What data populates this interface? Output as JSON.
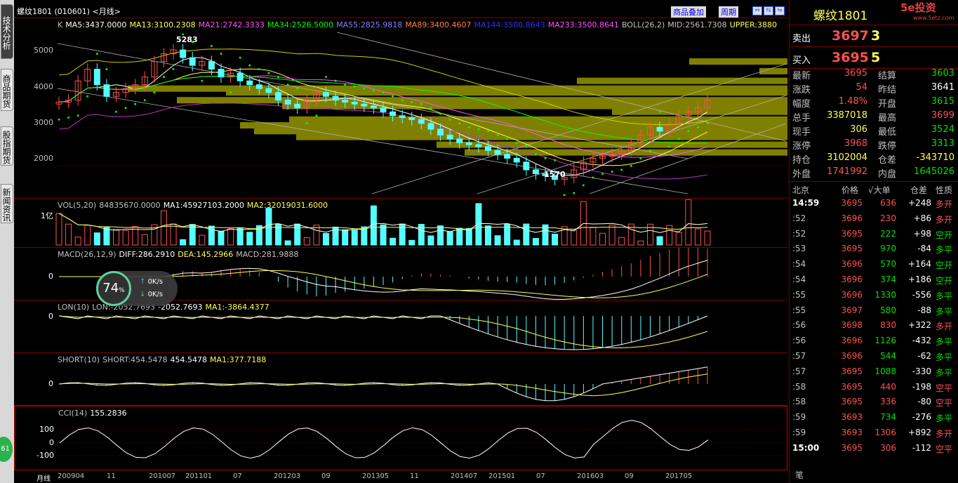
{
  "left_tabs": [
    "技术分析",
    "商品期货",
    "股指期货",
    "新闻资讯"
  ],
  "left_badge": "61",
  "header": {
    "title": "螺纹1801 (010601) <月线>",
    "menu_overlay": "商品叠加",
    "menu_period": "周期"
  },
  "main_panel": {
    "legend": [
      {
        "text": "K",
        "color": "#c0c0c0"
      },
      {
        "text": "MA5:3437.0000",
        "color": "#ffffff"
      },
      {
        "text": "MA13:3100.2308",
        "color": "#ffff54"
      },
      {
        "text": "MA21:2742.3333",
        "color": "#ff50ff"
      },
      {
        "text": "MA34:2526.5000",
        "color": "#00ff00"
      },
      {
        "text": "MA55:2825.9818",
        "color": "#8080ff"
      },
      {
        "text": "MA89:3400.4607",
        "color": "#ff8040"
      },
      {
        "text": "MA144:3500.8643",
        "color": "#3030ff"
      },
      {
        "text": "MA233:3500.8641",
        "color": "#ff50ff"
      },
      {
        "text": "BOLL(26,2)",
        "color": "#c0c0c0"
      },
      {
        "text": "MID:2561.7308",
        "color": "#c0c0c0"
      },
      {
        "text": "UPPER:3880",
        "color": "#ffff54"
      }
    ],
    "y_labels": [
      "5000",
      "4000",
      "3000",
      "2000"
    ],
    "high_label": "5283",
    "low_label": "1570"
  },
  "vol_panel": {
    "legend": [
      {
        "text": "VOL(5,20)",
        "color": "#c0c0c0"
      },
      {
        "text": "84835670.0000",
        "color": "#c0c0c0"
      },
      {
        "text": "MA1:45927103.2000",
        "color": "#ffffff"
      },
      {
        "text": "MA2:32019031.6000",
        "color": "#ffff54"
      }
    ],
    "y_label": "1亿"
  },
  "macd_panel": {
    "legend": [
      {
        "text": "MACD(26,12,9)",
        "color": "#c0c0c0"
      },
      {
        "text": "DIFF:286.2910",
        "color": "#ffffff"
      },
      {
        "text": "DEA:145.2966",
        "color": "#ffff54"
      },
      {
        "text": "MACD:281.9888",
        "color": "#c0c0c0"
      }
    ],
    "y_label": "0"
  },
  "lon_panel": {
    "legend": [
      {
        "text": "LON(10)",
        "color": "#c0c0c0"
      },
      {
        "text": "LON:-2052.7693",
        "color": "#c0c0c0"
      },
      {
        "text": "-2052.7693",
        "color": "#ffffff"
      },
      {
        "text": "MA1:-3864.4377",
        "color": "#ffff54"
      }
    ],
    "y_label": "0"
  },
  "short_panel": {
    "legend": [
      {
        "text": "SHORT(10)",
        "color": "#c0c0c0"
      },
      {
        "text": "SHORT:454.5478",
        "color": "#c0c0c0"
      },
      {
        "text": "454.5478",
        "color": "#ffffff"
      },
      {
        "text": "MA1:377.7188",
        "color": "#ffff54"
      }
    ],
    "y_label": "0"
  },
  "cci_panel": {
    "legend": [
      {
        "text": "CCI(14)",
        "color": "#c0c0c0"
      },
      {
        "text": "155.2836",
        "color": "#ffffff"
      }
    ],
    "y_labels": [
      "100",
      "0",
      "-100"
    ]
  },
  "x_axis": {
    "period": "月线",
    "labels": [
      "200904",
      "11",
      "201007",
      "201101",
      "07",
      "201203",
      "09",
      "201305",
      "11",
      "201407",
      "201501",
      "07",
      "201603",
      "09",
      "201705"
    ]
  },
  "network": {
    "percent": "74",
    "unit": "%",
    "up": "0K/s",
    "down": "0K/s"
  },
  "right_panel": {
    "title": "螺纹1801",
    "logo": "5e投资",
    "logo_sub": "www.5etz.com",
    "sell_label": "卖出",
    "sell_price": "3697",
    "sell_vol": "3",
    "buy_label": "买入",
    "buy_price": "3695",
    "buy_vol": "5",
    "quotes": [
      {
        "l1": "最新",
        "v1": "3695",
        "c1": "red",
        "l2": "结算",
        "v2": "3603",
        "c2": "green"
      },
      {
        "l1": "涨跌",
        "v1": "54",
        "c1": "red",
        "l2": "昨结",
        "v2": "3641",
        "c2": "white"
      },
      {
        "l1": "幅度",
        "v1": "1.48%",
        "c1": "red",
        "l2": "开盘",
        "v2": "3615",
        "c2": "green"
      },
      {
        "l1": "总手",
        "v1": "3387018",
        "c1": "yellow",
        "l2": "最高",
        "v2": "3699",
        "c2": "red"
      },
      {
        "l1": "现手",
        "v1": "306",
        "c1": "yellow",
        "l2": "最低",
        "v2": "3524",
        "c2": "green"
      },
      {
        "l1": "涨停",
        "v1": "3968",
        "c1": "red",
        "l2": "跌停",
        "v2": "3313",
        "c2": "green"
      },
      {
        "l1": "持仓",
        "v1": "3102004",
        "c1": "yellow",
        "l2": "仓差",
        "v2": "-343710",
        "c2": "yellow"
      },
      {
        "l1": "外盘",
        "v1": "1741992",
        "c1": "red",
        "l2": "内盘",
        "v2": "1645026",
        "c2": "green"
      }
    ],
    "tick_header": {
      "time": "北京",
      "price": "价格",
      "vol": "√大单",
      "oi": "仓差",
      "nature": "性质"
    },
    "ticks": [
      {
        "time": "14:59",
        "price": "3695",
        "vol": "636",
        "vc": "red",
        "oi": "+248",
        "nat": "多开",
        "nc": "red"
      },
      {
        "time": ":52",
        "price": "3696",
        "vol": "230",
        "vc": "red",
        "oi": "+86",
        "nat": "多开",
        "nc": "red"
      },
      {
        "time": ":52",
        "price": "3695",
        "vol": "222",
        "vc": "green",
        "oi": "+98",
        "nat": "空开",
        "nc": "green"
      },
      {
        "time": ":53",
        "price": "3695",
        "vol": "970",
        "vc": "green",
        "oi": "-84",
        "nat": "多平",
        "nc": "green"
      },
      {
        "time": ":54",
        "price": "3696",
        "vol": "570",
        "vc": "green",
        "oi": "+164",
        "nat": "空开",
        "nc": "green"
      },
      {
        "time": ":54",
        "price": "3696",
        "vol": "374",
        "vc": "green",
        "oi": "+186",
        "nat": "空开",
        "nc": "green"
      },
      {
        "time": ":55",
        "price": "3696",
        "vol": "1330",
        "vc": "green",
        "oi": "-556",
        "nat": "多平",
        "nc": "green"
      },
      {
        "time": ":55",
        "price": "3697",
        "vol": "580",
        "vc": "green",
        "oi": "-88",
        "nat": "多平",
        "nc": "green"
      },
      {
        "time": ":56",
        "price": "3698",
        "vol": "830",
        "vc": "red",
        "oi": "+322",
        "nat": "多开",
        "nc": "red"
      },
      {
        "time": ":56",
        "price": "3696",
        "vol": "1126",
        "vc": "green",
        "oi": "-432",
        "nat": "多平",
        "nc": "green"
      },
      {
        "time": ":57",
        "price": "3696",
        "vol": "544",
        "vc": "green",
        "oi": "-62",
        "nat": "多平",
        "nc": "green"
      },
      {
        "time": ":57",
        "price": "3695",
        "vol": "1088",
        "vc": "green",
        "oi": "-330",
        "nat": "多平",
        "nc": "green"
      },
      {
        "time": ":58",
        "price": "3695",
        "vol": "440",
        "vc": "red",
        "oi": "-198",
        "nat": "空平",
        "nc": "red"
      },
      {
        "time": ":58",
        "price": "3695",
        "vol": "336",
        "vc": "red",
        "oi": "-80",
        "nat": "空平",
        "nc": "red"
      },
      {
        "time": ":59",
        "price": "3693",
        "vol": "734",
        "vc": "green",
        "oi": "-276",
        "nat": "多平",
        "nc": "green"
      },
      {
        "time": ":59",
        "price": "3693",
        "vol": "1306",
        "vc": "red",
        "oi": "+892",
        "nat": "多开",
        "nc": "red"
      },
      {
        "time": "15:00",
        "price": "3695",
        "vol": "306",
        "vc": "red",
        "oi": "-112",
        "nat": "空平",
        "nc": "red"
      }
    ],
    "footer": "笔"
  },
  "colors": {
    "up": "#ff5050",
    "down": "#54ffff",
    "grid": "#7a0000",
    "ma_white": "#ffffff",
    "ma_yellow": "#ffff54",
    "ma_magenta": "#ff50ff",
    "ma_green": "#00ff00",
    "sar": "#00ff00",
    "volume_profile": "#808000"
  },
  "chart_data": {
    "type": "candlestick",
    "title": "螺纹1801 (010601) <月线>",
    "ylim": [
      1300,
      5600
    ],
    "approx_monthly_close": [
      3650,
      3700,
      4200,
      4500,
      4100,
      3800,
      3900,
      4000,
      4100,
      4300,
      4700,
      4900,
      5000,
      4800,
      4600,
      4700,
      4500,
      4300,
      4400,
      4200,
      4100,
      4000,
      3900,
      3700,
      3600,
      3500,
      3700,
      3900,
      3800,
      3700,
      3650,
      3600,
      3550,
      3500,
      3400,
      3300,
      3250,
      3200,
      3100,
      2950,
      2800,
      2700,
      2600,
      2550,
      2500,
      2400,
      2300,
      2200,
      2100,
      1900,
      1800,
      1750,
      1650,
      1700,
      1900,
      2100,
      2200,
      2250,
      2300,
      2400,
      2600,
      2800,
      3000,
      2900,
      3100,
      3300,
      3400,
      3500,
      3695
    ],
    "high": 5283,
    "low": 1570
  }
}
